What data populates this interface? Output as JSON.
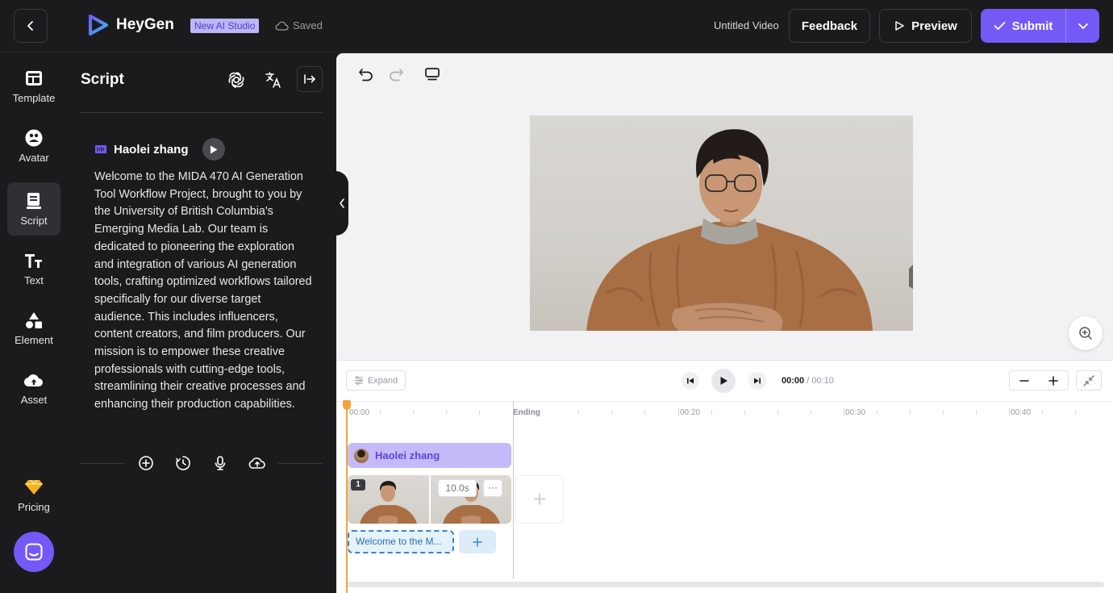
{
  "header": {
    "logo_text": "HeyGen",
    "badge": "New AI Studio",
    "saved": "Saved",
    "video_title": "Untitled Video",
    "feedback_label": "Feedback",
    "preview_label": "Preview",
    "submit_label": "Submit"
  },
  "nav": {
    "items": [
      {
        "label": "Template",
        "icon": "template-icon"
      },
      {
        "label": "Avatar",
        "icon": "avatar-icon"
      },
      {
        "label": "Script",
        "icon": "script-icon",
        "active": true
      },
      {
        "label": "Text",
        "icon": "text-icon"
      },
      {
        "label": "Element",
        "icon": "element-icon"
      },
      {
        "label": "Asset",
        "icon": "asset-icon"
      }
    ],
    "pricing_label": "Pricing"
  },
  "script_panel": {
    "title": "Script",
    "speaker": "Haolei zhang",
    "text": "Welcome to the MIDA 470 AI Generation Tool Workflow Project, brought to you by the University of British Columbia's Emerging Media Lab. Our team is dedicated to pioneering the exploration and integration of various AI generation tools, crafting optimized workflows tailored specifically for our diverse target audience. This includes influencers, content creators, and film producers. Our mission is to empower these creative professionals with cutting-edge tools, streamlining their creative processes and enhancing their production capabilities."
  },
  "timeline": {
    "expand_label": "Expand",
    "current_time": "00:00",
    "duration": "/ 00:10",
    "ruler": [
      "00:00",
      "Ending",
      "00:20",
      "00:30",
      "00:40"
    ],
    "avatar_track": "Haolei zhang",
    "clip_number": "1",
    "clip_duration": "10.0s",
    "clip_more": "···",
    "text_track": "Welcome to the M..."
  },
  "colors": {
    "accent": "#7559f6",
    "playhead": "#f3a43a",
    "text_track": "#3b82c4"
  }
}
